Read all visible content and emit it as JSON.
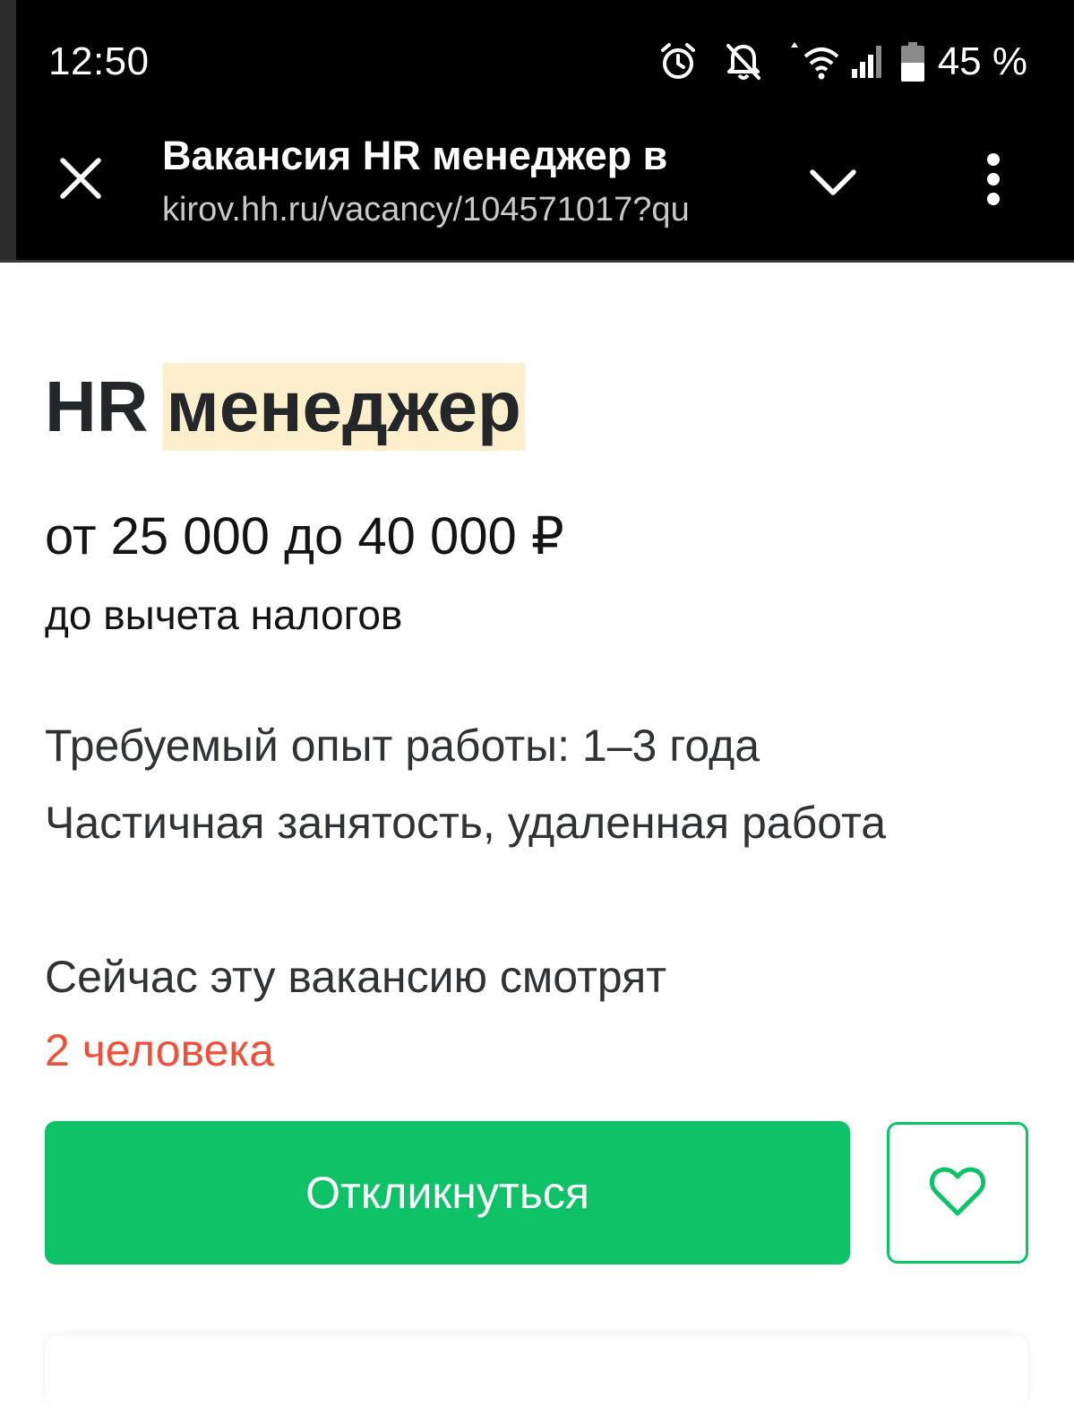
{
  "status_bar": {
    "time": "12:50",
    "battery_percent": "45 %",
    "icons": [
      "alarm-icon",
      "notifications-off-icon",
      "wifi-icon",
      "cellular-signal-icon",
      "battery-icon"
    ]
  },
  "browser_toolbar": {
    "page_title": "Вакансия HR менеджер в",
    "url": "kirov.hh.ru/vacancy/104571017?qu",
    "icons": [
      "close-icon",
      "chevron-down-icon",
      "more-vert-icon"
    ]
  },
  "vacancy": {
    "title_prefix": "HR",
    "title_highlight": "менеджер",
    "salary": "от 25 000 до 40 000 ₽",
    "salary_note": "до вычета налогов",
    "experience": "Требуемый опыт работы: 1–3 года",
    "employment": "Частичная занятость, удаленная работа",
    "viewers_label": "Сейчас эту вакансию смотрят",
    "viewers_count": "2 человека"
  },
  "actions": {
    "apply_label": "Откликнуться",
    "favorite_icon": "heart-icon"
  },
  "colors": {
    "accent_green": "#0dc267",
    "highlight": "#fdefcb",
    "viewers_red": "#f0503a",
    "toolbar_bg": "#000000"
  }
}
